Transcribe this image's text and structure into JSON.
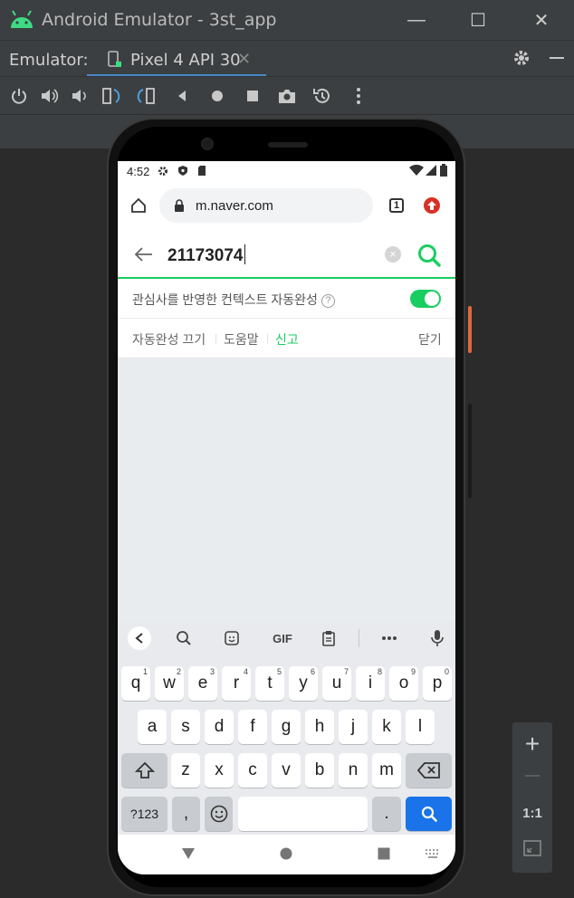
{
  "window": {
    "title": "Android Emulator - 3st_app",
    "minimize": "—",
    "maximize": "☐",
    "close": "✕"
  },
  "tabbar": {
    "label": "Emulator:",
    "tab_name": "Pixel 4 API 30",
    "tab_close": "✕"
  },
  "toolbar": {
    "items": [
      "power-icon",
      "volume-up-icon",
      "volume-down-icon",
      "rotate-left-icon",
      "rotate-right-icon",
      "back-icon",
      "home-icon",
      "overview-icon",
      "screenshot-icon",
      "snapshot-icon",
      "more-icon"
    ]
  },
  "phone": {
    "status": {
      "time": "4:52"
    },
    "browser": {
      "url": "m.naver.com",
      "tab_count": "1"
    },
    "search": {
      "query": "21173074",
      "clear": "×"
    },
    "context": {
      "label": "관심사를 반영한 컨텍스트 자동완성",
      "help": "?",
      "toggle_on": true
    },
    "links": {
      "off": "자동완성 끄기",
      "help": "도움말",
      "report": "신고",
      "close": "닫기"
    },
    "keyboard": {
      "tools": {
        "gif": "GIF"
      },
      "row1": [
        {
          "k": "q",
          "s": "1"
        },
        {
          "k": "w",
          "s": "2"
        },
        {
          "k": "e",
          "s": "3"
        },
        {
          "k": "r",
          "s": "4"
        },
        {
          "k": "t",
          "s": "5"
        },
        {
          "k": "y",
          "s": "6"
        },
        {
          "k": "u",
          "s": "7"
        },
        {
          "k": "i",
          "s": "8"
        },
        {
          "k": "o",
          "s": "9"
        },
        {
          "k": "p",
          "s": "0"
        }
      ],
      "row2": [
        "a",
        "s",
        "d",
        "f",
        "g",
        "h",
        "j",
        "k",
        "l"
      ],
      "row3": [
        "z",
        "x",
        "c",
        "v",
        "b",
        "n",
        "m"
      ],
      "symbols": "?123",
      "comma": ",",
      "period": "."
    }
  },
  "zoom": {
    "plus": "+",
    "minus": "—",
    "one_to_one": "1:1"
  },
  "colors": {
    "naver_green": "#19ce60",
    "key_blue": "#1a73e8",
    "ide_bg": "#3c3f41"
  }
}
